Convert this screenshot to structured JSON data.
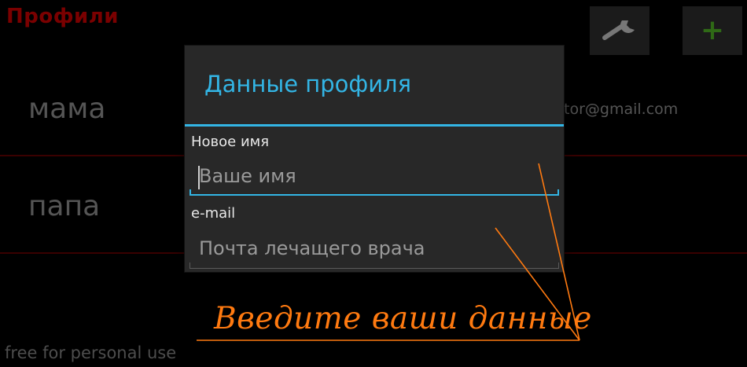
{
  "app": {
    "title": "Профили",
    "footer": "free for personal use"
  },
  "toolbar": {
    "settings_icon": "wrench-icon",
    "add_icon": "plus-icon",
    "add_glyph": "+"
  },
  "profiles": [
    {
      "name": "мама",
      "email": "tor@gmail.com"
    },
    {
      "name": "папа"
    }
  ],
  "dialog": {
    "title": "Данные профиля",
    "fields": [
      {
        "label": "Новое имя",
        "value": "",
        "placeholder": "Ваше имя"
      },
      {
        "label": "e-mail",
        "value": "",
        "placeholder": "Почта лечащего врача"
      }
    ]
  },
  "annotation": {
    "text": "Введите ваши данные",
    "color": "#ff7a10"
  },
  "colors": {
    "accent": "#33b5e5",
    "title_red": "#7a0000",
    "add_green": "#2f6a16"
  }
}
